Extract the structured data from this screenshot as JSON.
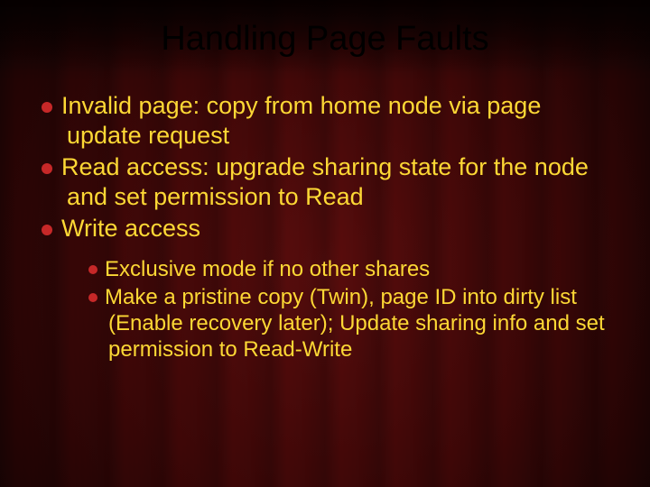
{
  "title": "Handling Page Faults",
  "bullets": [
    "Invalid page: copy from home node via page update request",
    "Read access: upgrade sharing state for the node and set permission to Read",
    "Write access"
  ],
  "sub_bullets": [
    "Exclusive mode if no other shares",
    "Make a pristine copy (Twin), page ID into dirty list (Enable recovery later); Update sharing info and set permission to Read-Write"
  ]
}
